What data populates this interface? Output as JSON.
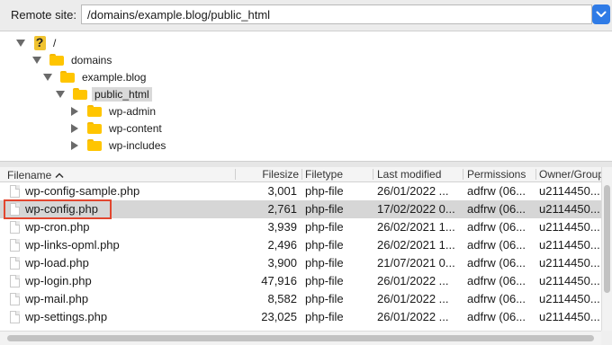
{
  "remote_site": {
    "label": "Remote site:",
    "path": "/domains/example.blog/public_html"
  },
  "tree": {
    "root_label": "/",
    "nodes": [
      {
        "label": "domains"
      },
      {
        "label": "example.blog"
      },
      {
        "label": "public_html",
        "selected": true
      },
      {
        "label": "wp-admin"
      },
      {
        "label": "wp-content"
      },
      {
        "label": "wp-includes"
      }
    ]
  },
  "file_list": {
    "columns": [
      {
        "label": "Filename",
        "sorted": "ascending"
      },
      {
        "label": "Filesize"
      },
      {
        "label": "Filetype"
      },
      {
        "label": "Last modified"
      },
      {
        "label": "Permissions"
      },
      {
        "label": "Owner/Group"
      }
    ],
    "rows": [
      {
        "name": "wp-config-sample.php",
        "size": "3,001",
        "type": "php-file",
        "modified": "26/01/2022 ...",
        "perms": "adfrw (06...",
        "owner": "u2114450..."
      },
      {
        "name": "wp-config.php",
        "size": "2,761",
        "type": "php-file",
        "modified": "17/02/2022 0...",
        "perms": "adfrw (06...",
        "owner": "u2114450...",
        "selected": true
      },
      {
        "name": "wp-cron.php",
        "size": "3,939",
        "type": "php-file",
        "modified": "26/02/2021 1...",
        "perms": "adfrw (06...",
        "owner": "u2114450..."
      },
      {
        "name": "wp-links-opml.php",
        "size": "2,496",
        "type": "php-file",
        "modified": "26/02/2021 1...",
        "perms": "adfrw (06...",
        "owner": "u2114450..."
      },
      {
        "name": "wp-load.php",
        "size": "3,900",
        "type": "php-file",
        "modified": "21/07/2021 0...",
        "perms": "adfrw (06...",
        "owner": "u2114450..."
      },
      {
        "name": "wp-login.php",
        "size": "47,916",
        "type": "php-file",
        "modified": "26/01/2022 ...",
        "perms": "adfrw (06...",
        "owner": "u2114450..."
      },
      {
        "name": "wp-mail.php",
        "size": "8,582",
        "type": "php-file",
        "modified": "26/01/2022 ...",
        "perms": "adfrw (06...",
        "owner": "u2114450..."
      },
      {
        "name": "wp-settings.php",
        "size": "23,025",
        "type": "php-file",
        "modified": "26/01/2022 ...",
        "perms": "adfrw (06...",
        "owner": "u2114450..."
      }
    ]
  },
  "colors": {
    "dropdown_accent": "#2f7be6",
    "folder": "#ffc500",
    "highlight_outline": "#e2462f",
    "selected_row": "#d6d6d6"
  }
}
